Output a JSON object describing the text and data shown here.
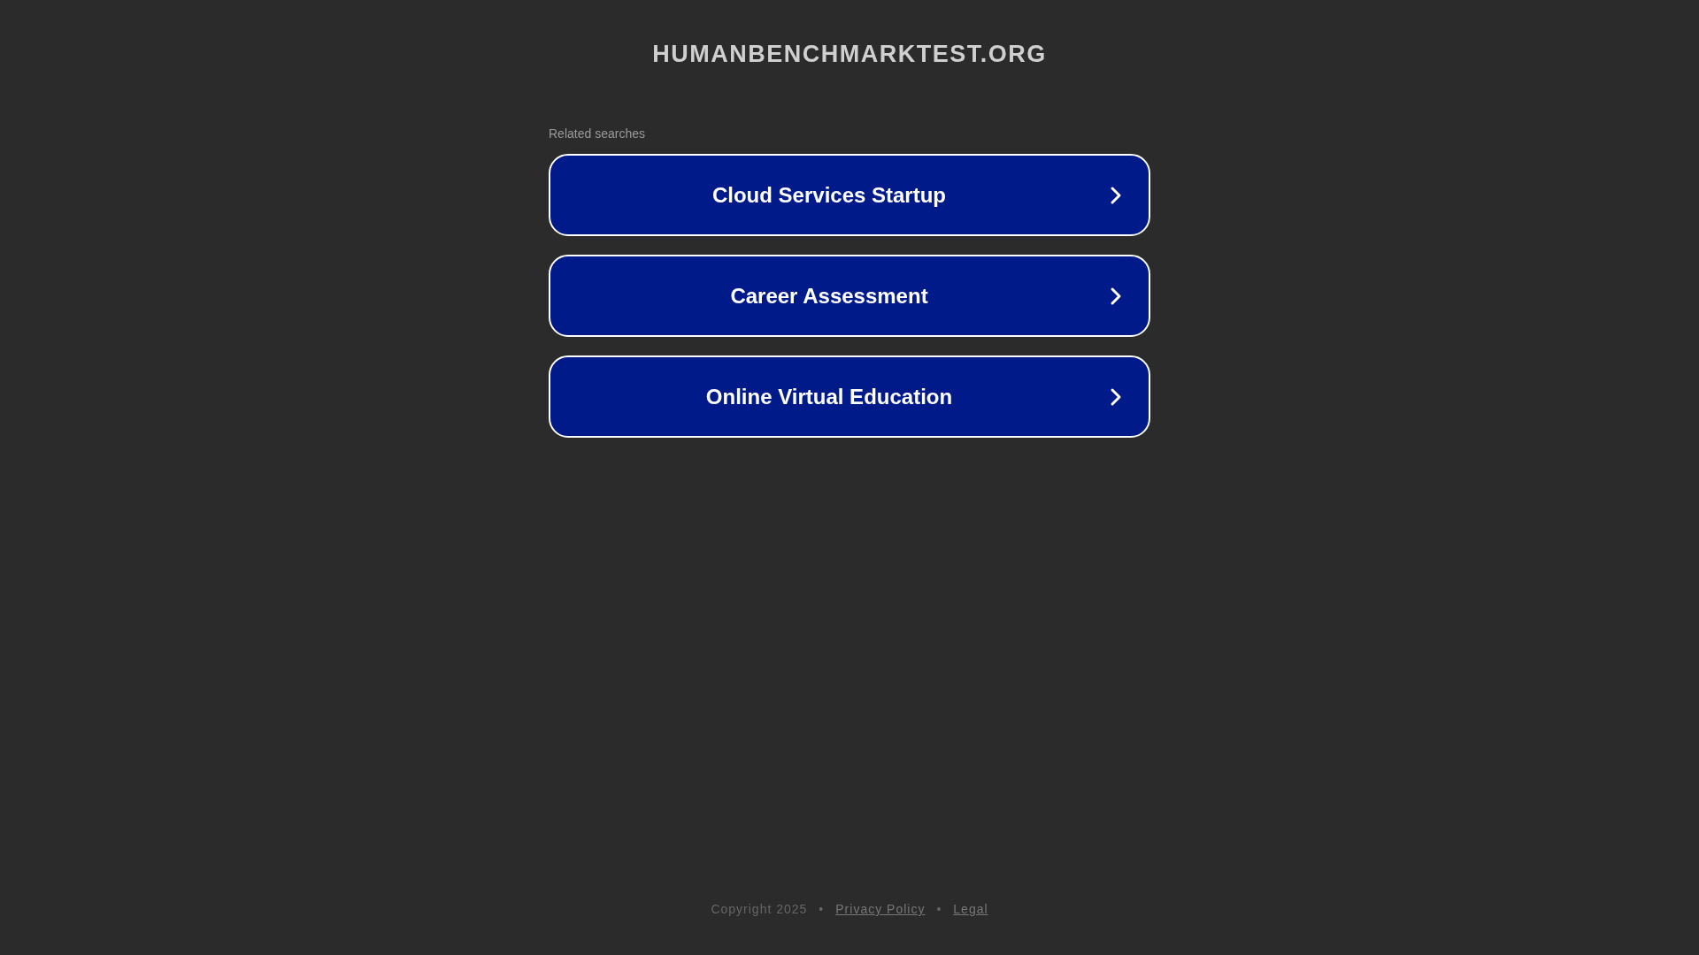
{
  "site_title": "HUMANBENCHMARKTEST.ORG",
  "related": {
    "heading": "Related searches",
    "items": [
      {
        "label": "Cloud Services Startup",
        "chevron": true
      },
      {
        "label": "Career Assessment",
        "chevron": true
      },
      {
        "label": "Online Virtual Education",
        "chevron": true
      }
    ]
  },
  "footer": [
    {
      "kind": "text",
      "text": "Copyright 2025"
    },
    {
      "kind": "separator",
      "text": "•"
    },
    {
      "kind": "link",
      "text": "Privacy Policy"
    },
    {
      "kind": "separator",
      "text": "•"
    },
    {
      "kind": "link",
      "text": "Legal"
    }
  ]
}
